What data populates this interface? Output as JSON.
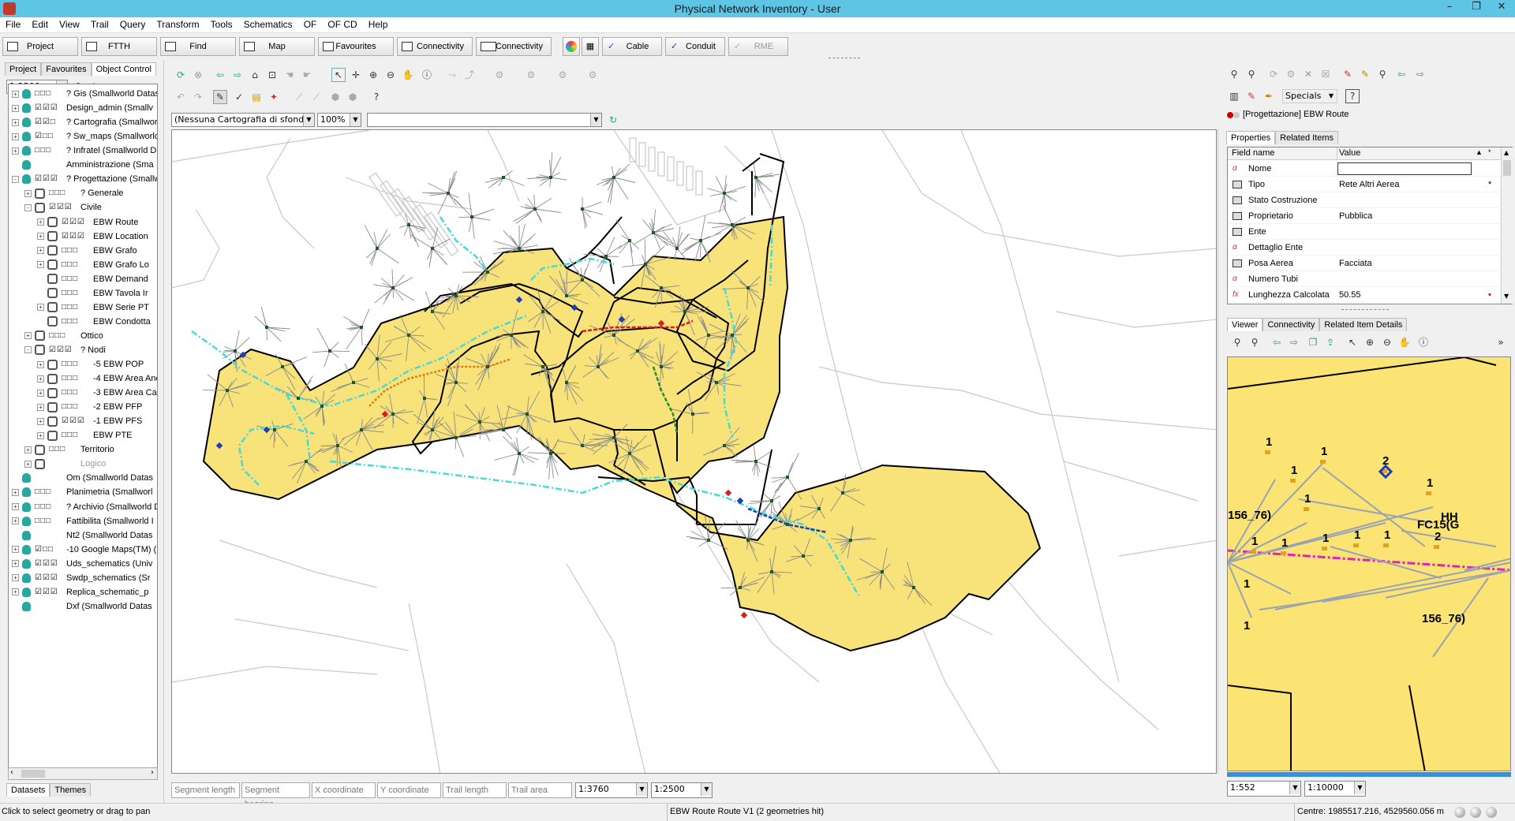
{
  "window": {
    "title": "Physical Network Inventory - User"
  },
  "menu": [
    "File",
    "Edit",
    "View",
    "Trail",
    "Query",
    "Transform",
    "Tools",
    "Schematics",
    "OF",
    "OF CD",
    "Help"
  ],
  "toolbar": {
    "buttons": [
      {
        "label": "Project",
        "icon": "project-icon"
      },
      {
        "label": "FTTH",
        "icon": "ftth-icon"
      },
      {
        "label": "Find",
        "icon": "find-icon"
      },
      {
        "label": "Map",
        "icon": "map-icon"
      },
      {
        "label": "Favourites",
        "icon": "favourites-icon"
      },
      {
        "label": "Connectivity",
        "icon": "connectivity-icon"
      },
      {
        "label": "Connectivity",
        "icon": "connectivity2-icon"
      },
      {
        "label": "Cable",
        "icon": "cable-icon"
      },
      {
        "label": "Conduit",
        "icon": "conduit-icon"
      },
      {
        "label": "RME",
        "icon": "rme-icon",
        "disabled": true
      }
    ]
  },
  "left": {
    "tabs": [
      "Project",
      "Favourites",
      "Object Control"
    ],
    "scale": "1:2500",
    "bottom_tabs": [
      "Datasets",
      "Themes"
    ],
    "tree": [
      {
        "lvl": 0,
        "ex": "+",
        "type": "db",
        "cb": "□□□",
        "label": "? Gis (Smallworld Datas"
      },
      {
        "lvl": 0,
        "ex": "+",
        "type": "db",
        "cb": "☑☑☑",
        "label": "Design_admin (Smallv"
      },
      {
        "lvl": 0,
        "ex": "+",
        "type": "db",
        "cb": "☑☑□",
        "label": "? Cartografia (Smallworl"
      },
      {
        "lvl": 0,
        "ex": "+",
        "type": "db",
        "cb": "☑□□",
        "label": "? Sw_maps (Smallworld"
      },
      {
        "lvl": 0,
        "ex": "+",
        "type": "db",
        "cb": "□□□",
        "label": "? Infratel (Smallworld Da"
      },
      {
        "lvl": 0,
        "ex": "",
        "type": "db",
        "cb": "",
        "label": "Amministrazione (Sma"
      },
      {
        "lvl": 0,
        "ex": "-",
        "type": "db",
        "cb": "☑☑☑",
        "label": "? Progettazione (Smallw"
      },
      {
        "lvl": 1,
        "ex": "+",
        "type": "gr",
        "cb": "□□□",
        "label": "? Generale"
      },
      {
        "lvl": 1,
        "ex": "-",
        "type": "gr",
        "cb": "☑☑☑",
        "label": "Civile"
      },
      {
        "lvl": 2,
        "ex": "+",
        "type": "gr",
        "cb": "☑☑☑",
        "label": "EBW Route"
      },
      {
        "lvl": 2,
        "ex": "+",
        "type": "gr",
        "cb": "☑☑☑",
        "label": "EBW Location"
      },
      {
        "lvl": 2,
        "ex": "+",
        "type": "gr",
        "cb": "□□□",
        "label": "EBW Grafo"
      },
      {
        "lvl": 2,
        "ex": "+",
        "type": "gr",
        "cb": "□□□",
        "label": "EBW Grafo Lo"
      },
      {
        "lvl": 2,
        "ex": "",
        "type": "gr",
        "cb": "□□□",
        "label": "EBW Demand"
      },
      {
        "lvl": 2,
        "ex": "",
        "type": "gr",
        "cb": "□□□",
        "label": "EBW Tavola Ir"
      },
      {
        "lvl": 2,
        "ex": "+",
        "type": "gr",
        "cb": "□□□",
        "label": "EBW Serie PT"
      },
      {
        "lvl": 2,
        "ex": "",
        "type": "gr",
        "cb": "□□□",
        "label": "EBW Condotta"
      },
      {
        "lvl": 1,
        "ex": "+",
        "type": "gr",
        "cb": "□□□",
        "label": "Ottico"
      },
      {
        "lvl": 1,
        "ex": "-",
        "type": "gr",
        "cb": "☑☑☑",
        "label": "? Nodi"
      },
      {
        "lvl": 2,
        "ex": "+",
        "type": "gr",
        "cb": "□□□",
        "label": "-5 EBW POP"
      },
      {
        "lvl": 2,
        "ex": "+",
        "type": "gr",
        "cb": "□□□",
        "label": "-4 EBW Area Ane"
      },
      {
        "lvl": 2,
        "ex": "+",
        "type": "gr",
        "cb": "□□□",
        "label": "-3 EBW Area Cav"
      },
      {
        "lvl": 2,
        "ex": "+",
        "type": "gr",
        "cb": "□□□",
        "label": "-2 EBW PFP"
      },
      {
        "lvl": 2,
        "ex": "+",
        "type": "gr",
        "cb": "☑☑☑",
        "label": "-1 EBW PFS"
      },
      {
        "lvl": 2,
        "ex": "+",
        "type": "gr",
        "cb": "□□□",
        "label": "EBW PTE"
      },
      {
        "lvl": 1,
        "ex": "+",
        "type": "gr",
        "cb": "□□□",
        "label": "Territorio"
      },
      {
        "lvl": 1,
        "ex": "+",
        "type": "gr",
        "cb": "",
        "label": "Logico",
        "grey": true
      },
      {
        "lvl": 0,
        "ex": "",
        "type": "db",
        "cb": "",
        "label": "Om (Smallworld Datas"
      },
      {
        "lvl": 0,
        "ex": "+",
        "type": "db",
        "cb": "□□□",
        "label": "Planimetria (Smallworl"
      },
      {
        "lvl": 0,
        "ex": "+",
        "type": "db",
        "cb": "□□□",
        "label": "? Archivio (Smallworld D"
      },
      {
        "lvl": 0,
        "ex": "+",
        "type": "db",
        "cb": "□□□",
        "label": "Fattibilita (Smallworld I"
      },
      {
        "lvl": 0,
        "ex": "",
        "type": "db",
        "cb": "",
        "label": "Nt2 (Smallworld Datas"
      },
      {
        "lvl": 0,
        "ex": "+",
        "type": "db",
        "cb": "☑□□",
        "label": "-10 Google Maps(TM) (U"
      },
      {
        "lvl": 0,
        "ex": "+",
        "type": "db",
        "cb": "☑☑☑",
        "label": "Uds_schematics (Univ"
      },
      {
        "lvl": 0,
        "ex": "+",
        "type": "db",
        "cb": "☑☑☑",
        "label": "Swdp_schematics (Sr"
      },
      {
        "lvl": 0,
        "ex": "+",
        "type": "db",
        "cb": "☑☑☑",
        "label": "Replica_schematic_p"
      },
      {
        "lvl": 0,
        "ex": "",
        "type": "db",
        "cb": "",
        "label": "Dxf (Smallworld Datas"
      }
    ]
  },
  "map": {
    "background_combo": "(Nessuna Cartografia di sfondo)",
    "zoom_combo": "100%",
    "status_cells": [
      "Segment length",
      "Segment bearing",
      "X coordinate",
      "Y coordinate",
      "Trail length",
      "Trail area"
    ],
    "scale1": "1:3760",
    "scale2": "1:2500",
    "area_color": "#f8e27a"
  },
  "right": {
    "specials": "Specials",
    "object_label": "[Progettazione] EBW Route",
    "prop_tabs": [
      "Properties",
      "Related Items"
    ],
    "columns": [
      "Field name",
      "Value"
    ],
    "props": [
      {
        "icon": "alpha",
        "name": "Nome",
        "value": ""
      },
      {
        "icon": "tb",
        "name": "Tipo",
        "value": "Rete Altri Aerea",
        "mark": "*"
      },
      {
        "icon": "tb",
        "name": "Stato Costruzione",
        "value": ""
      },
      {
        "icon": "tb",
        "name": "Proprietario",
        "value": "Pubblica"
      },
      {
        "icon": "tb",
        "name": "Ente",
        "value": ""
      },
      {
        "icon": "alpha",
        "name": "Dettaglio Ente",
        "value": ""
      },
      {
        "icon": "tb",
        "name": "Posa Aerea",
        "value": "Facciata"
      },
      {
        "icon": "alpha",
        "name": "Numero Tubi",
        "value": ""
      },
      {
        "icon": "fx",
        "name": "Lunghezza Calcolata",
        "value": "50.55",
        "mark": "•"
      }
    ],
    "viewer_tabs": [
      "Viewer",
      "Connectivity",
      "Related Item Details"
    ],
    "viewer_labels": [
      "1",
      "1",
      "2",
      "1",
      "1",
      "1",
      "1",
      "1",
      "1",
      "1",
      "1",
      "2",
      "1",
      "1",
      "156_76)",
      "FC15(G",
      "HH"
    ],
    "scale1": "1:552",
    "scale2": "1:10000"
  },
  "statusbar": {
    "hint": "Click to select geometry or drag to pan",
    "selection": "EBW Route Route V1 (2 geometries hit)",
    "centre": "Centre: 1985517.216, 4529560.056 m"
  }
}
